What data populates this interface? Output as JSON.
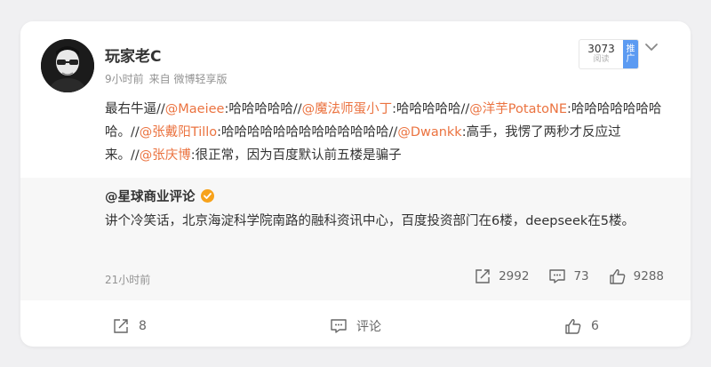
{
  "author": {
    "name": "玩家老C"
  },
  "meta": {
    "time": "9小时前",
    "source": "来自 微博轻享版"
  },
  "read_badge": {
    "count": "3073",
    "label": "阅读",
    "promo_1": "推",
    "promo_2": "广"
  },
  "post": {
    "s1": "最右牛逼//",
    "m1": "@Maeiee",
    "s2": ":哈哈哈哈哈//",
    "m2": "@魔法师蛋小丁",
    "s3": ":哈哈哈哈哈//",
    "m3": "@洋芋PotatoNE",
    "s4": ":哈哈哈哈哈哈哈哈。//",
    "m4": "@张戴阳Tillo",
    "s5": ":哈哈哈哈哈哈哈哈哈哈哈哈哈//",
    "m5": "@Dwankk",
    "s6": ":高手，我愣了两秒才反应过来。//",
    "m6": "@张庆博",
    "s7": ":很正常，因为百度默认前五楼是骗子"
  },
  "repost": {
    "author": "@星球商业评论",
    "text": "讲个冷笑话，北京海淀科学院南路的融科资讯中心，百度投资部门在6楼，deepseek在5楼。",
    "time": "21小时前",
    "reposts": "2992",
    "comments": "73",
    "likes": "9288"
  },
  "actions": {
    "repost_count": "8",
    "comment_label": "评论",
    "like_count": "6"
  },
  "icons": [
    "avatar",
    "chevron-down-icon",
    "verified-icon",
    "repost-icon",
    "comment-icon",
    "like-icon"
  ],
  "colors": {
    "mention": "#eb7340",
    "verified": "#f7a21b",
    "promo": "#5c9bf2"
  }
}
